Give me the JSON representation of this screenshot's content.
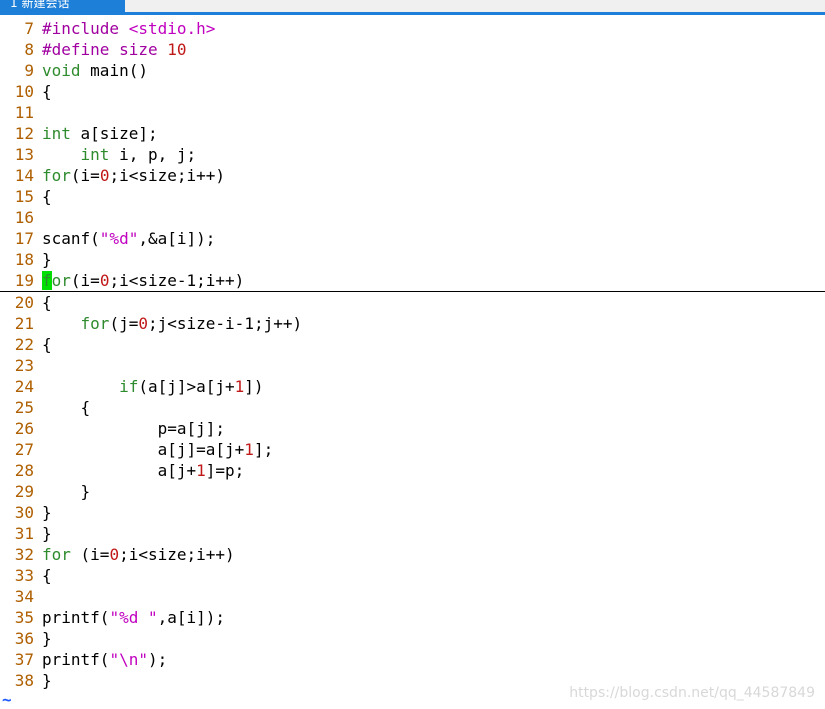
{
  "tab": {
    "label": "1 新建会话"
  },
  "editor": {
    "lines": [
      {
        "n": "7",
        "segs": [
          {
            "t": "#include ",
            "c": "pp"
          },
          {
            "t": "<stdio.h>",
            "c": "str"
          }
        ]
      },
      {
        "n": "8",
        "segs": [
          {
            "t": "#define ",
            "c": "pp"
          },
          {
            "t": "size ",
            "c": "pp"
          },
          {
            "t": "10",
            "c": "num"
          }
        ]
      },
      {
        "n": "9",
        "segs": [
          {
            "t": "void ",
            "c": "kw"
          },
          {
            "t": "main()",
            "c": ""
          }
        ]
      },
      {
        "n": "10",
        "segs": [
          {
            "t": "{",
            "c": ""
          }
        ]
      },
      {
        "n": "11",
        "segs": []
      },
      {
        "n": "12",
        "segs": [
          {
            "t": "int ",
            "c": "kw"
          },
          {
            "t": "a[size];",
            "c": ""
          }
        ]
      },
      {
        "n": "13",
        "segs": [
          {
            "t": "    ",
            "c": ""
          },
          {
            "t": "int ",
            "c": "kw"
          },
          {
            "t": "i, p, j;",
            "c": ""
          }
        ]
      },
      {
        "n": "14",
        "segs": [
          {
            "t": "for",
            "c": "kw"
          },
          {
            "t": "(i=",
            "c": ""
          },
          {
            "t": "0",
            "c": "num"
          },
          {
            "t": ";i<size;i++)",
            "c": ""
          }
        ]
      },
      {
        "n": "15",
        "segs": [
          {
            "t": "{",
            "c": ""
          }
        ]
      },
      {
        "n": "16",
        "segs": []
      },
      {
        "n": "17",
        "segs": [
          {
            "t": "scanf(",
            "c": ""
          },
          {
            "t": "\"%d\"",
            "c": "str"
          },
          {
            "t": ",&a[i]);",
            "c": ""
          }
        ]
      },
      {
        "n": "18",
        "segs": [
          {
            "t": "}",
            "c": ""
          }
        ]
      },
      {
        "n": "19",
        "cursor": true,
        "segs": [
          {
            "t": "f",
            "c": "cursor"
          },
          {
            "t": "or",
            "c": "kw"
          },
          {
            "t": "(i=",
            "c": ""
          },
          {
            "t": "0",
            "c": "num"
          },
          {
            "t": ";i<size-1;i++)",
            "c": ""
          }
        ]
      },
      {
        "n": "20",
        "segs": [
          {
            "t": "{",
            "c": ""
          }
        ]
      },
      {
        "n": "21",
        "segs": [
          {
            "t": "    ",
            "c": ""
          },
          {
            "t": "for",
            "c": "kw"
          },
          {
            "t": "(j=",
            "c": ""
          },
          {
            "t": "0",
            "c": "num"
          },
          {
            "t": ";j<size-i-1;j++)",
            "c": ""
          }
        ]
      },
      {
        "n": "22",
        "segs": [
          {
            "t": "{",
            "c": ""
          }
        ]
      },
      {
        "n": "23",
        "segs": []
      },
      {
        "n": "24",
        "segs": [
          {
            "t": "        ",
            "c": ""
          },
          {
            "t": "if",
            "c": "kw"
          },
          {
            "t": "(a[j]>a[j+",
            "c": ""
          },
          {
            "t": "1",
            "c": "num"
          },
          {
            "t": "])",
            "c": ""
          }
        ]
      },
      {
        "n": "25",
        "segs": [
          {
            "t": "    {",
            "c": ""
          }
        ]
      },
      {
        "n": "26",
        "segs": [
          {
            "t": "            p=a[j];",
            "c": ""
          }
        ]
      },
      {
        "n": "27",
        "segs": [
          {
            "t": "            a[j]=a[j+",
            "c": ""
          },
          {
            "t": "1",
            "c": "num"
          },
          {
            "t": "];",
            "c": ""
          }
        ]
      },
      {
        "n": "28",
        "segs": [
          {
            "t": "            a[j+",
            "c": ""
          },
          {
            "t": "1",
            "c": "num"
          },
          {
            "t": "]=p;",
            "c": ""
          }
        ]
      },
      {
        "n": "29",
        "segs": [
          {
            "t": "    }",
            "c": ""
          }
        ]
      },
      {
        "n": "30",
        "segs": [
          {
            "t": "}",
            "c": ""
          }
        ]
      },
      {
        "n": "31",
        "segs": [
          {
            "t": "}",
            "c": ""
          }
        ]
      },
      {
        "n": "32",
        "segs": [
          {
            "t": "for ",
            "c": "kw"
          },
          {
            "t": "(i=",
            "c": ""
          },
          {
            "t": "0",
            "c": "num"
          },
          {
            "t": ";i<size;i++)",
            "c": ""
          }
        ]
      },
      {
        "n": "33",
        "segs": [
          {
            "t": "{",
            "c": ""
          }
        ]
      },
      {
        "n": "34",
        "segs": []
      },
      {
        "n": "35",
        "segs": [
          {
            "t": "printf(",
            "c": ""
          },
          {
            "t": "\"%d \"",
            "c": "str"
          },
          {
            "t": ",a[i]);",
            "c": ""
          }
        ]
      },
      {
        "n": "36",
        "segs": [
          {
            "t": "}",
            "c": ""
          }
        ]
      },
      {
        "n": "37",
        "segs": [
          {
            "t": "printf(",
            "c": ""
          },
          {
            "t": "\"\\n\"",
            "c": "str"
          },
          {
            "t": ");",
            "c": ""
          }
        ]
      },
      {
        "n": "38",
        "segs": [
          {
            "t": "}",
            "c": ""
          }
        ]
      }
    ],
    "tilde": "~"
  },
  "watermark": "https://blog.csdn.net/qq_44587849",
  "colors": {
    "tab": "#1e7fd8",
    "line_number": "#af5f00",
    "keyword": "#2e8b2e",
    "preprocessor": "#a000a0",
    "string": "#c000c0",
    "number": "#c01818",
    "cursor": "#00e000"
  }
}
